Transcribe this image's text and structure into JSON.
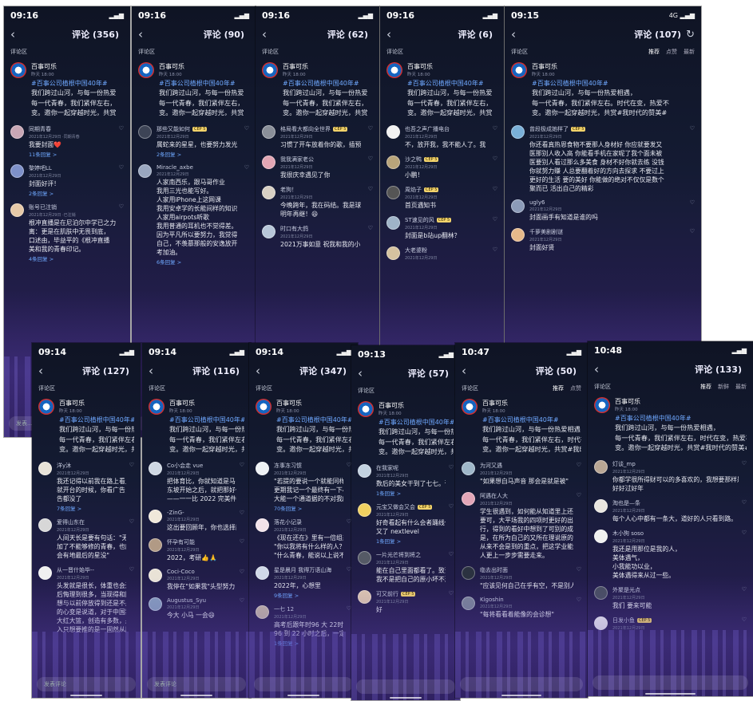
{
  "phones": [
    {
      "time": "09:16",
      "signal": "",
      "title": "评论 (356)",
      "refresh": false,
      "sort": [],
      "zone": "评论区",
      "input": "发表...",
      "avatar_color": "#c9a7b5",
      "post": {
        "name": "百事可乐",
        "meta": "昨天 18:00",
        "tag": "#百事公司植根中国40年#",
        "lines": [
          "我们跨过山河，与每一份热爱",
          "每一代青春，我们紧伴左右，",
          "变。邀你一起穿越时光，共赏"
        ]
      },
      "comments": [
        {
          "name": "同期青春",
          "badge": "",
          "meta": "2021年12月29日 ·同期青春",
          "lines": [
            "我要封面❤️"
          ],
          "replies": "11条回复 >",
          "color": "#c9a7b5"
        },
        {
          "name": "黎婷吧LL",
          "badge": "",
          "meta": "2021年12月29日",
          "lines": [
            "封面好评！"
          ],
          "replies": "2条回复 >",
          "color": "#7e91c9"
        },
        {
          "name": "账号已注销",
          "badge": "",
          "meta": "2021年12月29日 ·已注销",
          "lines": [
            "根冲直播是在尼泊尔中学已之力",
            "离：更是在肌肤中无畏到底，",
            "口述由，毕益平的《根冲直播",
            "美和我的青春印记。"
          ],
          "replies": "4条回复 >",
          "color": "#e6c9a8"
        }
      ]
    },
    {
      "time": "09:16",
      "signal": "",
      "title": "评论 (90)",
      "refresh": false,
      "sort": [],
      "zone": "评论区",
      "input": "",
      "avatar_color": "#6d7fa8",
      "post": {
        "name": "百事可乐",
        "meta": "昨天 18:00",
        "tag": "#百事公司植根中国40年#",
        "lines": [
          "我们跨过山河，与每一份热爱",
          "每一代青春，我们紧伴左右，",
          "变。邀你一起穿越时光，共赏"
        ]
      },
      "comments": [
        {
          "name": "那些又能如何",
          "badge": "CEP 5",
          "meta": "2021年12月29日",
          "lines": [
            "属蛇来的星星，也要努力发光"
          ],
          "replies": "2条回复 >",
          "color": "#3d4456"
        },
        {
          "name": "Miracle_axbe",
          "badge": "",
          "meta": "2021年12月29日",
          "lines": [
            "人家南西乐，跟马哥作业",
            "我用三光也能写好。",
            "人家用iPhone上这网课",
            "我用安卓学的长能间样的知识",
            "人家用airpots听歌",
            "我用普通的耳机也不觉得差。",
            "因为平凡所以要努力，我觉得",
            "自己，不羡慕那般的安逸放开",
            "考加油。"
          ],
          "replies": "6条回复 >",
          "color": "#9aa7bf"
        }
      ]
    },
    {
      "time": "09:16",
      "signal": "",
      "title": "评论 (62)",
      "refresh": false,
      "sort": [],
      "zone": "评论区",
      "input": "",
      "avatar_color": "#e2a6b4",
      "post": {
        "name": "百事可乐",
        "meta": "昨天 18:00",
        "tag": "#百事公司植根中国40年#",
        "lines": [
          "我们跨过山河，与每一份热爱",
          "每一代青春，我们紧伴左右，",
          "变。邀你一起穿越时光，共赏"
        ]
      },
      "comments": [
        {
          "name": "格局看大都向全世界",
          "badge": "CEP 5",
          "meta": "2021年12月29日",
          "lines": [
            "习惯了开车放着你的歌，插预"
          ],
          "replies": "",
          "color": "#8a8f99"
        },
        {
          "name": "我我满家老公",
          "badge": "",
          "meta": "2021年12月29日",
          "lines": [
            "我很庆幸遇见了你"
          ],
          "replies": "",
          "color": "#e2a6b4"
        },
        {
          "name": "老狗！",
          "badge": "",
          "meta": "2021年12月29日",
          "lines": [
            "今晚跨年，我在码结。我是球",
            "明年再继！😄"
          ],
          "replies": "",
          "color": "#d8d0c4"
        },
        {
          "name": "时口有大鸽",
          "badge": "",
          "meta": "2021年12月29日",
          "lines": [
            "2021万事如意 祝我和我的小"
          ],
          "replies": "",
          "color": "#b7c6d8"
        }
      ]
    },
    {
      "time": "09:16",
      "signal": "",
      "title": "评论 (6)",
      "refresh": false,
      "sort": [],
      "zone": "评论区",
      "input": "",
      "avatar_color": "#f0f0f0",
      "post": {
        "name": "百事可乐",
        "meta": "昨天 18:00",
        "tag": "#百事公司植根中国40年#",
        "lines": [
          "我们跨过山河，与每一份热爱",
          "每一代青春，我们紧伴左右，",
          "变。邀你一起穿越时光，共赏"
        ]
      },
      "comments": [
        {
          "name": "也吾之声广播电台",
          "badge": "",
          "meta": "2021年12月29日",
          "lines": [
            "不，放开我，我不能人了。我"
          ],
          "replies": "",
          "color": "#f2f2f2"
        },
        {
          "name": "沙之鸭",
          "badge": "CEP 5",
          "meta": "2021年12月29日",
          "lines": [
            "小鹏！"
          ],
          "replies": "",
          "color": "#b8a47a"
        },
        {
          "name": "周焰子",
          "badge": "CEP 5",
          "meta": "2021年12月29日",
          "lines": [
            "首页遇知书"
          ],
          "replies": "",
          "color": "#555"
        },
        {
          "name": "ST速见的风",
          "badge": "CEP 5",
          "meta": "2021年12月29日",
          "lines": [
            "封面是b站up翻林？"
          ],
          "replies": "",
          "color": "#9fb4c8"
        },
        {
          "name": "大老婆粉",
          "badge": "",
          "meta": "2021年12月29日",
          "lines": [],
          "replies": "",
          "color": "#d5c2a0"
        }
      ]
    },
    {
      "time": "09:15",
      "signal": "4G",
      "title": "评论 (107)",
      "refresh": true,
      "sort": [
        "推荐",
        "点赞",
        "最新"
      ],
      "zone": "评论区",
      "input": "",
      "avatar_color": "#7ab0d8",
      "post": {
        "name": "百事可乐",
        "meta": "昨天 18:00",
        "tag": "#百事公司植根中国40年#",
        "lines": [
          "我们跨过山河，与每一份热爱相遇，",
          "每一代青春，我们紧伴左右。时代在变，热爱不",
          "变。邀你一起穿越时光，共赏#我时代的赞美#"
        ]
      },
      "comments": [
        {
          "name": "曾段极成她样了",
          "badge": "CEP 5",
          "meta": "2021年12月29日",
          "lines": [
            "你还看真热恩食物不要那人身材好 你应就要发又",
            "医那别人收入高 你能看手机在家呢了我个面未被",
            "医要别人看过那么多美食 身材不好你就去练 没钱",
            "你就努力赚 人总要翻着好的方向去探求 不要过上",
            "更好的生活 要的美好 你能做的绝对不仅仅是数个",
            "聚而已 活出自己的精彩"
          ],
          "replies": "",
          "color": "#7ab0d8"
        },
        {
          "name": "ugly6",
          "badge": "",
          "meta": "2021年12月29日",
          "lines": [
            "封面画手有知道是谁的吗"
          ],
          "replies": "",
          "color": "#8c9bb8"
        },
        {
          "name": "千萝美剧剧谜",
          "badge": "",
          "meta": "2021年12月29日",
          "lines": [
            "封面好贤"
          ],
          "replies": "",
          "color": "#e6b98a"
        }
      ]
    },
    {
      "time": "09:14",
      "signal": "",
      "title": "评论 (127)",
      "refresh": false,
      "sort": [],
      "zone": "评论区",
      "input": "发表评论",
      "avatar_color": "#e8e3d8",
      "post": {
        "name": "百事可乐",
        "meta": "昨天 18:00",
        "tag": "#百事公司植根中国40年#",
        "lines": [
          "我们跨过山河，与每一份热爱",
          "每一代青春，我们紧伴左右，",
          "变。邀你一起穿越时光，共赏"
        ]
      },
      "comments": [
        {
          "name": "洋y沐",
          "badge": "",
          "meta": "2021年12月29日",
          "lines": [
            "我还记得以前我在路上看见这个",
            "就开台的时候，你看广告，广",
            "告都没了"
          ],
          "replies": "7条回复 >",
          "color": "#e8e3d8"
        },
        {
          "name": "爱得山东在",
          "badge": "",
          "meta": "2021年12月29日",
          "lines": [
            "人间天长是要有句话：\"无处可",
            "加了不能够修的青春，也能把青",
            "会有地最后的星没\""
          ],
          "replies": "",
          "color": "#d7d7d7"
        },
        {
          "name": "从一晋什始毕--",
          "badge": "",
          "meta": "2021年12月29日",
          "lines": [
            "头发就是很长，体重也会还长，",
            "后悔理到很多，当现得和刚到了",
            "想与以前停放得到还是不是，不",
            "的心变是说道，对于中国我，完",
            "大红大篮，创造有多数，是完完",
            "入只想要推的是一固然从原地说"
          ],
          "replies": "",
          "color": "#f0f0f0"
        }
      ]
    },
    {
      "time": "09:14",
      "signal": "",
      "title": "评论 (116)",
      "refresh": false,
      "sort": [],
      "zone": "评论区",
      "input": "发表评论",
      "avatar_color": "#cfd8e3",
      "post": {
        "name": "百事可乐",
        "meta": "昨天 18:00",
        "tag": "#百事公司植根中国40年#",
        "lines": [
          "我们跨过山河，与每一份热爱",
          "每一代青春，我们紧伴左右，",
          "变。邀你一起穿越时光，共赏"
        ]
      },
      "comments": [
        {
          "name": "Co小会走 vue",
          "badge": "",
          "meta": "2021年12月29日",
          "lines": [
            "把体育比，你就知道是马",
            "东坡开始之后，就把那好一次",
            "——一一比 2022 完美件"
          ],
          "replies": "",
          "color": "#cfd8e3"
        },
        {
          "name": "-ZinG-",
          "badge": "",
          "meta": "2021年12月29日",
          "lines": [
            "这出要回顾年，你也选择前馈"
          ],
          "replies": "",
          "color": "#f0e8da"
        },
        {
          "name": "怀孕有可能",
          "badge": "",
          "meta": "2021年12月29日",
          "lines": [
            "2022，考研👍🙏"
          ],
          "replies": "",
          "color": "#b19a85"
        },
        {
          "name": "Coci-Coco",
          "badge": "",
          "meta": "2021年12月29日",
          "lines": [
            "我停在\"如果我\"头型努力"
          ],
          "replies": "",
          "color": "#e9e2d6"
        },
        {
          "name": "Augustus_Syu",
          "badge": "",
          "meta": "2021年12月29日",
          "lines": [
            "今大 小马 一会😄"
          ],
          "replies": "",
          "color": "#8aa1c0"
        }
      ]
    },
    {
      "time": "09:14",
      "signal": "",
      "title": "评论 (347)",
      "refresh": false,
      "sort": [],
      "zone": "评论区",
      "input": "",
      "avatar_color": "#eef2f5",
      "post": {
        "name": "百事可乐",
        "meta": "昨天 18:00",
        "tag": "#百事公司植根中国40年#",
        "lines": [
          "我们跨过山河，与每一份热爱",
          "每一代青春，我们紧伴左右，",
          "变。邀你一起穿越时光，共赏"
        ]
      },
      "comments": [
        {
          "name": "冻事冻习惯",
          "badge": "",
          "meta": "2021年12月29日",
          "lines": [
            "\"若提的要说一个就能同样无尽",
            "更期我记一个最终有一下小的",
            "大能一个通道据的不对我的小盘"
          ],
          "replies": "70条回复 >",
          "color": "#eef2f5"
        },
        {
          "name": "落花小记录",
          "badge": "",
          "meta": "2021年12月29日",
          "lines": [
            "《现在还在》里有一倍组来同",
            "\"你以我将有什么样的人？\"",
            "\"什么青春，能说以上说不年"
          ],
          "replies": "",
          "color": "#f3e3ea"
        },
        {
          "name": "星是晨月 我得万语山海",
          "badge": "",
          "meta": "2021年12月29日",
          "lines": [
            "2022年，心想里"
          ],
          "replies": "9条回复 >",
          "color": "#d0d8e8"
        },
        {
          "name": "一七 12",
          "badge": "",
          "meta": "2021年12月29日",
          "lines": [
            "高考后跟年时96 大 22时",
            "96 到 22 小时之后，一定要啊"
          ],
          "replies": "1条回复 >",
          "color": "#c6b7a8"
        }
      ]
    },
    {
      "time": "09:13",
      "signal": "",
      "title": "评论 (57)",
      "refresh": false,
      "sort": [],
      "zone": "评论区",
      "input": "",
      "avatar_color": "#c3d2e0",
      "post": {
        "name": "百事可乐",
        "meta": "昨天 18:00",
        "tag": "#百事公司植根中国40年#",
        "lines": [
          "我们跨过山河，与每一份热爱",
          "每一代青春，我们紧伴左右，",
          "变。邀你一起穿越时光，共赏"
        ]
      },
      "comments": [
        {
          "name": "在我家呢",
          "badge": "",
          "meta": "2021年12月29日",
          "lines": [
            "数后的美女干到了七七。否则者"
          ],
          "replies": "1条回复 >",
          "color": "#c3d2e0"
        },
        {
          "name": "元宝又做会又会",
          "badge": "CEP 5",
          "meta": "2021年12月29日",
          "lines": [
            "好奇看起有什么会者踊线个看",
            "又了 nextlevel"
          ],
          "replies": "1条回复 >",
          "color": "#f0d060"
        },
        {
          "name": "一片光芒将到将之",
          "badge": "",
          "meta": "2021年12月29日",
          "lines": [
            "能在自己里面都看了。致谢完整",
            "我不是把自己的原小坏不满。😄"
          ],
          "replies": "",
          "color": "#555a66"
        },
        {
          "name": "可又前行",
          "badge": "CEP 5",
          "meta": "2021年12月29日",
          "lines": [
            "好"
          ],
          "replies": "",
          "color": "#e0c8b0"
        }
      ]
    },
    {
      "time": "10:47",
      "signal": "",
      "title": "评论 (50)",
      "refresh": false,
      "sort": [
        "推荐",
        "点赞"
      ],
      "zone": "评论区",
      "input": "",
      "avatar_color": "#b8c7d6",
      "post": {
        "name": "百事可乐",
        "meta": "昨天 18:00",
        "tag": "#百事公司植根中国40年#",
        "lines": [
          "我们跨过山河，与每一份热爱相遇，",
          "每一代青春，我们紧伴左右，时代在变，",
          "变。邀你一起穿越时光，共赏#我时代的"
        ]
      },
      "comments": [
        {
          "name": "为河又遇",
          "badge": "",
          "meta": "2021年12月29日",
          "lines": [
            "\"如果想自马声音 那会是就是被\""
          ],
          "replies": "",
          "color": "#9fb7c9"
        },
        {
          "name": "阿遇在人大",
          "badge": "",
          "meta": "2021年12月29日",
          "lines": [
            "学生很遇到，如何能从知道里上还过去看",
            "要可，大平场我的四项时更好的出所。今",
            "行，得到的看好中想到了可别的成，我去",
            "是，在所为自己的又所在理说原的。但",
            "从来不会是到的重点，把这学业能开会不",
            "人更上一步步需要走来。"
          ],
          "replies": "",
          "color": "#e3a6b8"
        },
        {
          "name": "临去出时面",
          "badge": "",
          "meta": "2021年12月29日",
          "lines": [
            "\"应该见何自己在乎有空，不是别人的需\""
          ],
          "replies": "",
          "color": "#2b3240"
        },
        {
          "name": "Kigoshin",
          "badge": "",
          "meta": "2021年12月29日",
          "lines": [
            "\"每将看看着能像的会诊想\""
          ],
          "replies": "",
          "color": "#7d8799"
        }
      ]
    },
    {
      "time": "10:48",
      "signal": "",
      "title": "评论 (133)",
      "refresh": false,
      "sort": [
        "推荐",
        "新鲜",
        "最新"
      ],
      "zone": "评论区",
      "input": "",
      "avatar_color": "#b9a795",
      "post": {
        "name": "百事可乐",
        "meta": "昨天 18:00",
        "tag": "#百事公司植根中国40年#",
        "lines": [
          "我们跨过山河，与每一份热爱相遇，",
          "每一代青春，我们紧伴左右，时代在变，热爱不",
          "变。邀你一起穿越时光，共赏#我时代的赞美#"
        ]
      },
      "comments": [
        {
          "name": "灯谈_mp",
          "badge": "",
          "meta": "2021年12月29日",
          "lines": [
            "你都学很所得财可以的多喜欢的，我想要那样是和",
            "好好过好年"
          ],
          "replies": "",
          "color": "#b9a795"
        },
        {
          "name": "淘也是—条",
          "badge": "",
          "meta": "2021年12月29日",
          "lines": [
            "每个人心中都有一条大，道好的人只看到路。"
          ],
          "replies": "",
          "color": "#e9e6e0"
        },
        {
          "name": "木小狗 soso",
          "badge": "",
          "meta": "2021年12月29日",
          "lines": [
            "我还是用那位是我的人，",
            "美体遇气，",
            "小我能功以业，",
            "美体遇得来从过一些。"
          ],
          "replies": "",
          "color": "#f0f0f0"
        },
        {
          "name": "外聚是光点",
          "badge": "",
          "meta": "2021年12月29日",
          "lines": [
            "我们 要来可能"
          ],
          "replies": "",
          "color": "#4a5060"
        },
        {
          "name": "日发小鱼",
          "badge": "CEP 5",
          "meta": "2021年12月29日",
          "lines": [],
          "replies": "",
          "color": "#f2f2f2"
        }
      ]
    }
  ]
}
